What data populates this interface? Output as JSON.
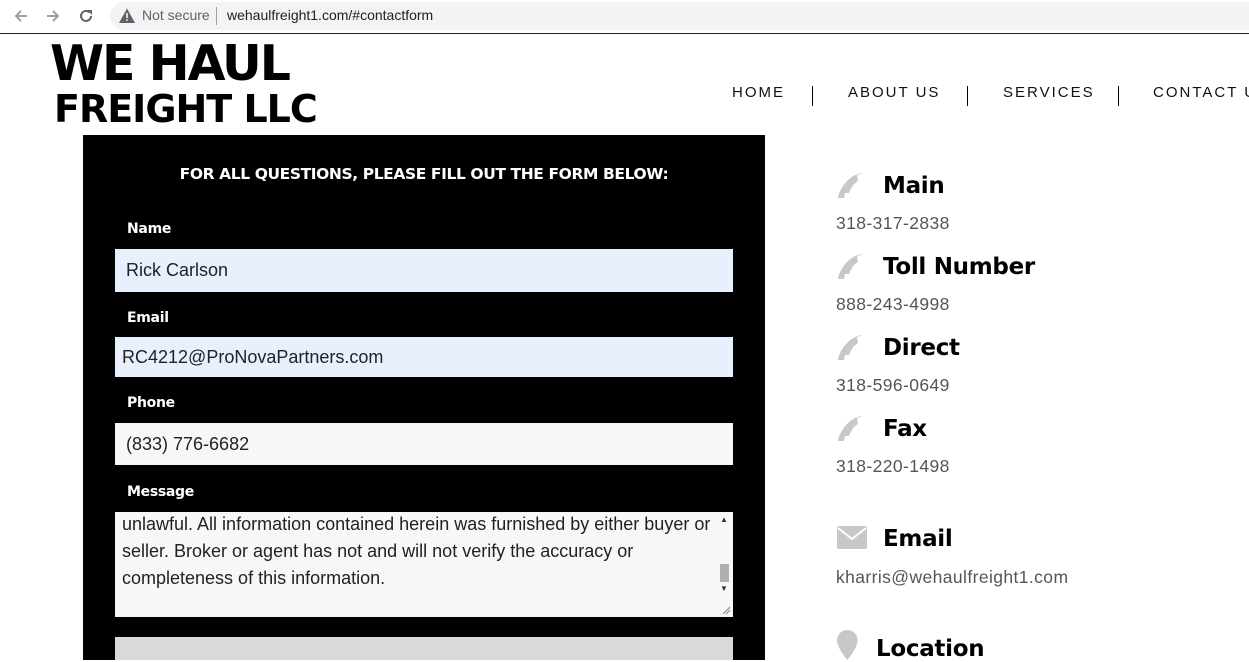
{
  "browser": {
    "security_label": "Not secure",
    "url": "wehaulfreight1.com/#contactform",
    "icons": [
      "back-arrow-icon",
      "forward-arrow-icon",
      "reload-icon",
      "warning-icon"
    ]
  },
  "header": {
    "logo_line1": "WE HAUL",
    "logo_line2": "FREIGHT LLC",
    "nav": [
      "HOME",
      "ABOUT US",
      "SERVICES",
      "CONTACT U"
    ]
  },
  "form": {
    "title": "FOR ALL QUESTIONS, PLEASE FILL OUT THE FORM BELOW:",
    "name_label": "Name",
    "name_value": "Rick Carlson",
    "email_label": "Email",
    "email_value": "RC4212@ProNovaPartners.com",
    "phone_label": "Phone",
    "phone_value": "(833) 776-6682",
    "message_label": "Message",
    "message_value": "unlawful.  All information contained herein was furnished by either buyer or seller.  Broker or agent has not and will not verify the accuracy or completeness of this information."
  },
  "contact": {
    "main_title": "Main",
    "main_value": "318-317-2838",
    "toll_title": "Toll Number",
    "toll_value": "888-243-4998",
    "direct_title": "Direct",
    "direct_value": "318-596-0649",
    "fax_title": "Fax",
    "fax_value": "318-220-1498",
    "email_title": "Email",
    "email_value": "kharris@wehaulfreight1.com",
    "location_title": "Location",
    "icon_color": "#c8c8c8"
  }
}
